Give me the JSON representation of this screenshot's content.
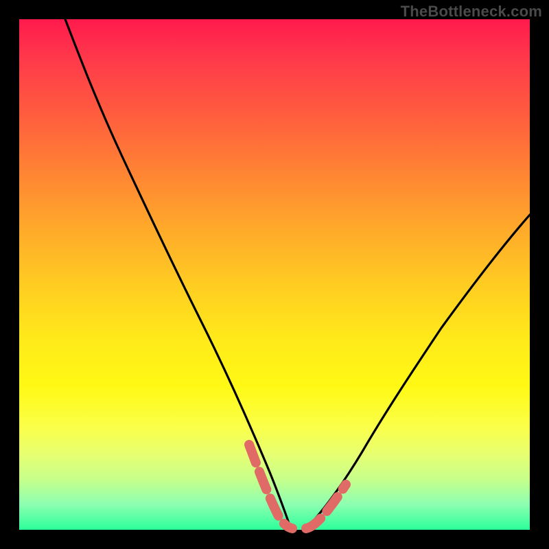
{
  "watermark": "TheBottleneck.com",
  "colors": {
    "frame": "#000000",
    "gradient_top": "#ff1a4d",
    "gradient_bottom": "#2bff9a",
    "curve": "#000000",
    "highlight": "#e06a65"
  },
  "chart_data": {
    "type": "line",
    "title": "",
    "xlabel": "",
    "ylabel": "",
    "xlim": [
      0,
      100
    ],
    "ylim": [
      0,
      100
    ],
    "series": [
      {
        "name": "left-curve",
        "x": [
          9,
          12,
          16,
          20,
          25,
          30,
          35,
          40,
          44,
          47,
          50,
          52
        ],
        "y": [
          100,
          92,
          83,
          73,
          61,
          49,
          37,
          25,
          14,
          6,
          1,
          0
        ]
      },
      {
        "name": "right-curve",
        "x": [
          55,
          58,
          62,
          67,
          72,
          78,
          84,
          90,
          96,
          100
        ],
        "y": [
          0,
          1,
          4,
          10,
          18,
          28,
          39,
          49,
          58,
          63
        ]
      }
    ],
    "highlight_segments": [
      {
        "series": "left-curve",
        "x": [
          44,
          47,
          49,
          51,
          52
        ],
        "y": [
          14,
          6,
          2,
          0.5,
          0
        ]
      },
      {
        "series": "right-curve",
        "x": [
          55,
          57,
          59,
          61
        ],
        "y": [
          0,
          0.8,
          2,
          4
        ]
      }
    ]
  }
}
